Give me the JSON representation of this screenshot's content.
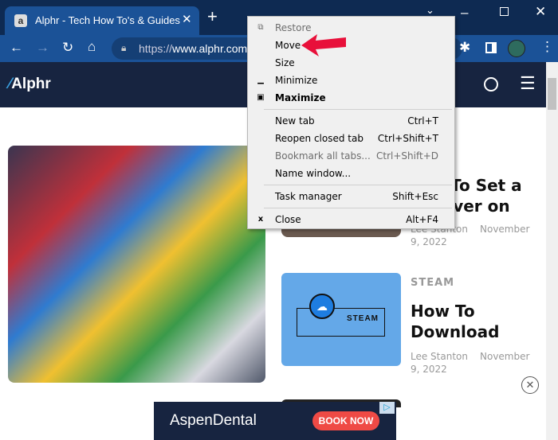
{
  "browser": {
    "tab_title": "Alphr - Tech How To's & Guides",
    "url_scheme": "https://",
    "url_host": "www.alphr.com"
  },
  "site": {
    "logo": "Alphr"
  },
  "articles": [
    {
      "title_line1": "To Set a",
      "title_line2": "ensaver on",
      "author": "Lee Stanton",
      "date_line1": "November",
      "date_line2": "9, 2022"
    },
    {
      "category": "STEAM",
      "title_line1": "How To",
      "title_line2": "Download",
      "author": "Lee Stanton",
      "date_line1": "November",
      "date_line2": "9, 2022",
      "thumb_label": "STEAM"
    }
  ],
  "ad": {
    "brand": "AspenDental",
    "cta": "BOOK NOW"
  },
  "menu": {
    "items": [
      {
        "label": "Restore",
        "shortcut": "",
        "disabled": true
      },
      {
        "label": "Move",
        "shortcut": ""
      },
      {
        "label": "Size",
        "shortcut": ""
      },
      {
        "label": "Minimize",
        "shortcut": ""
      },
      {
        "label": "Maximize",
        "shortcut": "",
        "bold": true
      },
      {
        "label": "New tab",
        "shortcut": "Ctrl+T"
      },
      {
        "label": "Reopen closed tab",
        "shortcut": "Ctrl+Shift+T"
      },
      {
        "label": "Bookmark all tabs...",
        "shortcut": "Ctrl+Shift+D",
        "disabled": true
      },
      {
        "label": "Name window...",
        "shortcut": ""
      },
      {
        "label": "Task manager",
        "shortcut": "Shift+Esc"
      },
      {
        "label": "Close",
        "shortcut": "Alt+F4"
      }
    ]
  },
  "colors": {
    "arrow": "#e8103a",
    "tabstrip": "#0e2a52",
    "toolbar": "#1b5297",
    "site_header": "#172440"
  }
}
